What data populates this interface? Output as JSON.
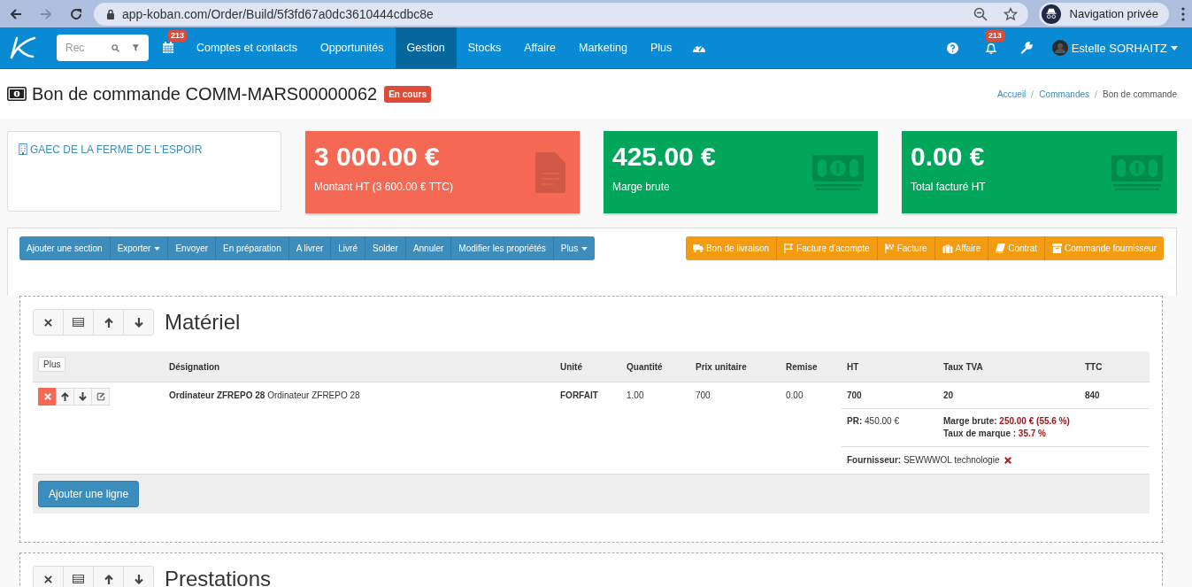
{
  "browser": {
    "url": "app-koban.com/Order/Build/5f3fd67a0dc3610444cdbc8e",
    "profile": "Navigation privée"
  },
  "navbar": {
    "search_placeholder": "Rec",
    "calendar_badge": "213",
    "items": [
      {
        "label": "Comptes et contacts",
        "selected": false
      },
      {
        "label": "Opportunités",
        "selected": false
      },
      {
        "label": "Gestion",
        "selected": true
      },
      {
        "label": "Stocks",
        "selected": false
      },
      {
        "label": "Affaire",
        "selected": false
      },
      {
        "label": "Marketing",
        "selected": false
      },
      {
        "label": "Plus",
        "selected": false
      }
    ],
    "notifications_badge": "213",
    "user": "Estelle SORHAITZ"
  },
  "header": {
    "title": "Bon de commande COMM-MARS00000062",
    "status": "En cours",
    "breadcrumb": [
      "Accueil",
      "Commandes",
      "Bon de commande"
    ]
  },
  "account": {
    "name": "GAEC DE LA FERME DE L'ESPOIR"
  },
  "stats": [
    {
      "value": "3 000.00 €",
      "label": "Montant HT (3 600.00 € TTC)",
      "color": "#f56954",
      "kind": "document"
    },
    {
      "value": "425.00 €",
      "label": "Marge brute",
      "color": "#00a65a",
      "kind": "money"
    },
    {
      "value": "0.00 €",
      "label": "Total facturé HT",
      "color": "#00a65a",
      "kind": "money"
    }
  ],
  "actions": [
    {
      "label": "Ajouter une section",
      "dropdown": false
    },
    {
      "label": "Exporter",
      "dropdown": true
    },
    {
      "label": "Envoyer",
      "dropdown": false
    },
    {
      "label": "En préparation",
      "dropdown": false
    },
    {
      "label": "A livrer",
      "dropdown": false
    },
    {
      "label": "Livré",
      "dropdown": false
    },
    {
      "label": "Solder",
      "dropdown": false
    },
    {
      "label": "Annuler",
      "dropdown": false
    },
    {
      "label": "Modifier les propriétés",
      "dropdown": false
    },
    {
      "label": "Plus",
      "dropdown": true
    }
  ],
  "documents": [
    {
      "label": "Bon de livraison",
      "kind": "truck"
    },
    {
      "label": "Facture d'acompte",
      "kind": "flag"
    },
    {
      "label": "Facture",
      "kind": "checkered-flag"
    },
    {
      "label": "Affaire",
      "kind": "briefcase"
    },
    {
      "label": "Contrat",
      "kind": "book"
    },
    {
      "label": "Commande fournisseur",
      "kind": "archive"
    }
  ],
  "sections": [
    {
      "title": "Matériel",
      "plus": "Plus",
      "columns": [
        "Désignation",
        "Unité",
        "Quantité",
        "Prix unitaire",
        "Remise",
        "HT",
        "Taux TVA",
        "TTC"
      ],
      "rows": [
        {
          "name": "Ordinateur ZFREPO 28",
          "description": "Ordinateur ZFREPO 28",
          "unit": "FORFAIT",
          "quantity": "1.00",
          "unit_price": "700",
          "discount": "0.00",
          "ht": "700",
          "vat": "20",
          "ttc": "840",
          "cost_label": "PR:",
          "cost": "450.00 €",
          "margin_label": "Marge brute:",
          "margin": "250.00 € (55.6 %)",
          "markup_label": "Taux de marque :",
          "markup": "35.7 %",
          "supplier_label": "Fournisseur:",
          "supplier": "SEWWWOL technologie"
        }
      ],
      "add_line": "Ajouter une ligne"
    },
    {
      "title": "Prestations"
    }
  ]
}
